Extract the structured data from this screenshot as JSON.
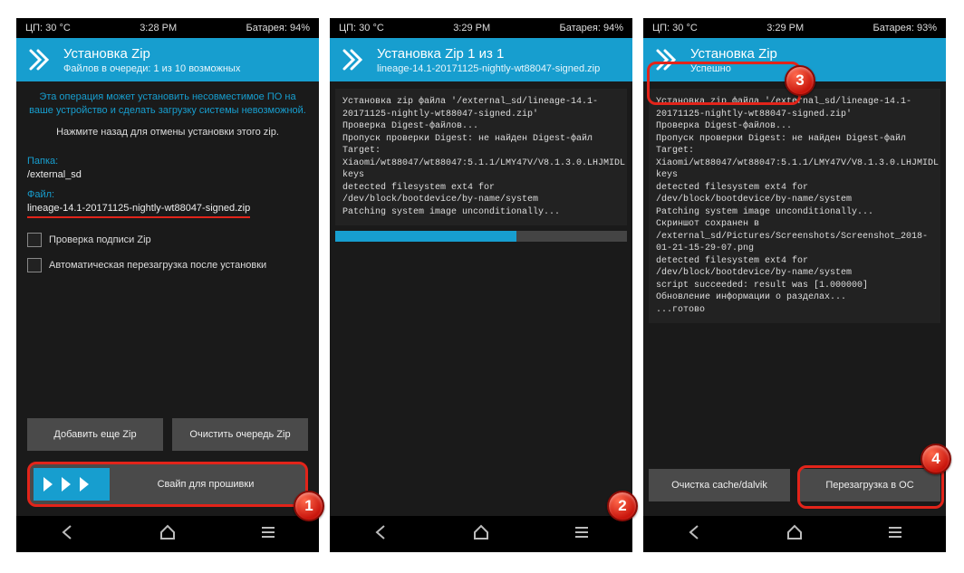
{
  "screens": [
    {
      "status": {
        "cpu": "ЦП: 30 °C",
        "time": "3:28 PM",
        "battery": "Батарея: 94%"
      },
      "header": {
        "title": "Установка Zip",
        "subtitle": "Файлов в очереди: 1 из 10 возможных"
      },
      "warn1": "Эта операция может установить несовместимое ПО на",
      "warn2": "ваше устройство и сделать загрузку системы невозможной.",
      "info": "Нажмите назад для отмены установки этого zip.",
      "folder_label": "Папка:",
      "folder_value": "/external_sd",
      "file_label": "Файл:",
      "file_value": "lineage-14.1-20171125-nightly-wt88047-signed.zip",
      "chk1": "Проверка подписи Zip",
      "chk2": "Автоматическая перезагрузка после установки",
      "btn_add": "Добавить еще Zip",
      "btn_clear": "Очистить очередь Zip",
      "swipe": "Свайп для прошивки"
    },
    {
      "status": {
        "cpu": "ЦП: 30 °C",
        "time": "3:29 PM",
        "battery": "Батарея: 94%"
      },
      "header": {
        "title": "Установка Zip 1 из 1",
        "subtitle": "lineage-14.1-20171125-nightly-wt88047-signed.zip"
      },
      "log": "Установка zip файла '/external_sd/lineage-14.1-20171125-nightly-wt88047-signed.zip'\nПроверка Digest-файлов...\nПропуск проверки Digest: не найден Digest-файл\nTarget: Xiaomi/wt88047/wt88047:5.1.1/LMY47V/V8.1.3.0.LHJMIDL:user/release-keys\ndetected filesystem ext4 for /dev/block/bootdevice/by-name/system\nPatching system image unconditionally..."
    },
    {
      "status": {
        "cpu": "ЦП: 30 °C",
        "time": "3:29 PM",
        "battery": "Батарея: 93%"
      },
      "header": {
        "title": "Установка Zip",
        "subtitle": "Успешно"
      },
      "log": "Установка zip файла '/external_sd/lineage-14.1-20171125-nightly-wt88047-signed.zip'\nПроверка Digest-файлов...\nПропуск проверки Digest: не найден Digest-файл\nTarget: Xiaomi/wt88047/wt88047:5.1.1/LMY47V/V8.1.3.0.LHJMIDL:user/release-keys\ndetected filesystem ext4 for /dev/block/bootdevice/by-name/system\nPatching system image unconditionally...\nСкриншот сохранен в /external_sd/Pictures/Screenshots/Screenshot_2018-01-21-15-29-07.png\ndetected filesystem ext4 for /dev/block/bootdevice/by-name/system\nscript succeeded: result was [1.000000]\nОбновление информации о разделах...\n...готово",
      "btn_wipe": "Очистка cache/dalvik",
      "btn_reboot": "Перезагрузка в ОС"
    }
  ]
}
